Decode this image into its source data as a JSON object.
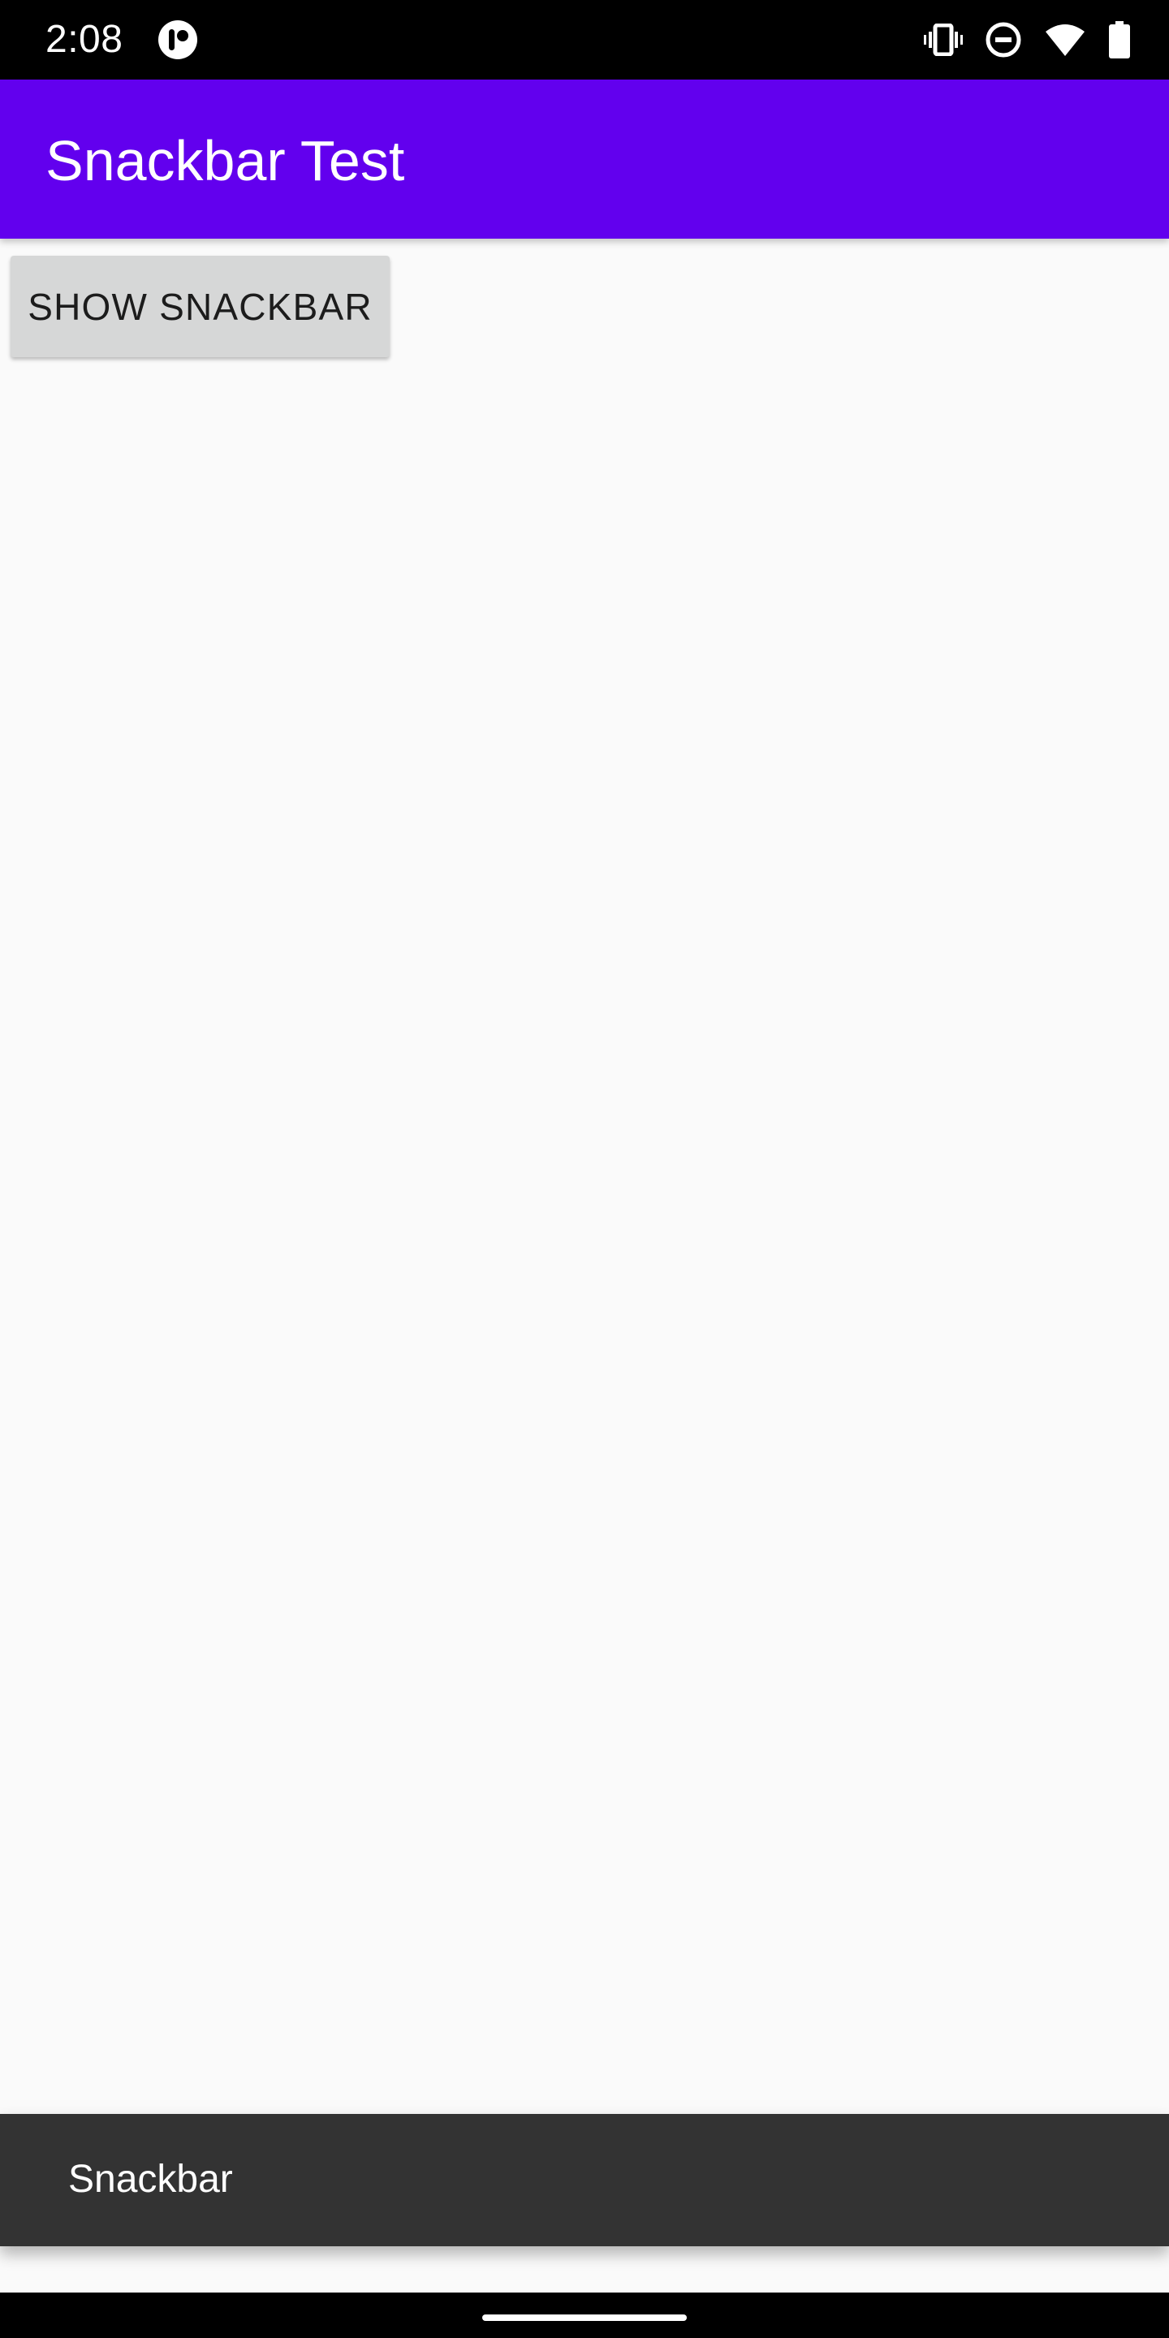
{
  "status_bar": {
    "time": "2:08",
    "icons": [
      "app-notification-icon",
      "vibrate-icon",
      "do-not-disturb-icon",
      "wifi-icon",
      "battery-icon"
    ]
  },
  "app_bar": {
    "title": "Snackbar Test",
    "color": "#6200ee"
  },
  "main": {
    "button_label": "SHOW SNACKBAR"
  },
  "snackbar": {
    "message": "Snackbar",
    "color": "#333333"
  },
  "colors": {
    "background": "#fafafa",
    "button": "#d6d7d7"
  }
}
